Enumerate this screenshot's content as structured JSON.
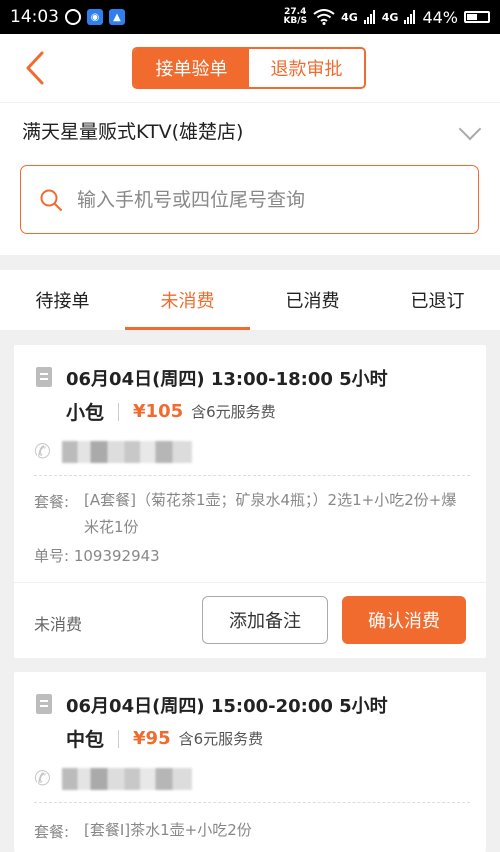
{
  "status_bar": {
    "time": "14:03",
    "speed_value": "27.4",
    "speed_unit": "KB/S",
    "signal1": "4G",
    "signal2": "4G",
    "battery": "44%"
  },
  "header": {
    "back_icon": "chevron-left-icon",
    "seg_active": "接单验单",
    "seg_inactive": "退款审批",
    "accent_color": "#f26b2e"
  },
  "store": {
    "name": "满天星量贩式KTV(雄楚店)",
    "dropdown_icon": "chevron-down-icon"
  },
  "search": {
    "placeholder": "输入手机号或四位尾号查询",
    "value": ""
  },
  "tabs": [
    {
      "label": "待接单",
      "active": false
    },
    {
      "label": "未消费",
      "active": true
    },
    {
      "label": "已消费",
      "active": false
    },
    {
      "label": "已退订",
      "active": false
    }
  ],
  "orders": [
    {
      "datetime": "06月04日(周四) 13:00-18:00 5小时",
      "room": "小包",
      "price": "¥105",
      "fee": "含6元服务费",
      "package_label": "套餐:",
      "package": "[A套餐]（菊花茶1壶；矿泉水4瓶；）2选1+小吃2份+爆米花1份",
      "order_no": "单号: 109392943",
      "status": "未消费",
      "note_button": "添加备注",
      "confirm_button": "确认消费"
    },
    {
      "datetime": "06月04日(周四) 15:00-20:00 5小时",
      "room": "中包",
      "price": "¥95",
      "fee": "含6元服务费",
      "package_label": "套餐:",
      "package": "[套餐I]茶水1壶+小吃2份"
    }
  ]
}
